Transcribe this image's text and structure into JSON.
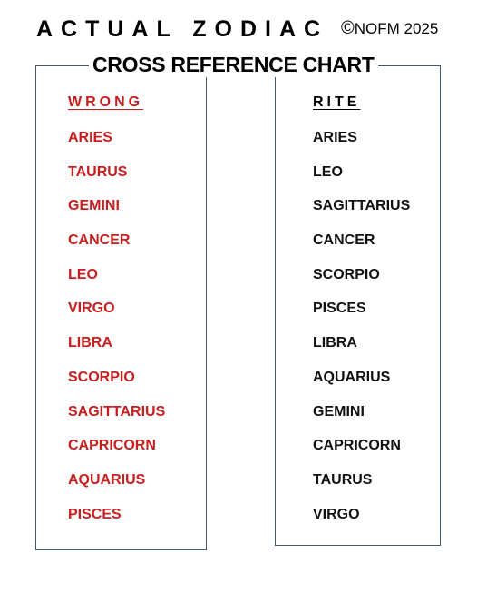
{
  "header": {
    "title": "ACTUAL ZODIAC",
    "copyright_symbol": "©",
    "copyright_text": "NOFM 2025",
    "subtitle": "CROSS REFERENCE CHART"
  },
  "columns": {
    "wrong": {
      "heading": "WRONG",
      "color": "#c81e1e",
      "items": [
        "ARIES",
        "TAURUS",
        "GEMINI",
        "CANCER",
        "LEO",
        "VIRGO",
        "LIBRA",
        "SCORPIO",
        "SAGITTARIUS",
        "CAPRICORN",
        "AQUARIUS",
        "PISCES"
      ]
    },
    "rite": {
      "heading": "RITE",
      "color": "#000000",
      "items": [
        "ARIES",
        "LEO",
        "SAGITTARIUS",
        "CANCER",
        "SCORPIO",
        "PISCES",
        "LIBRA",
        "AQUARIUS",
        "GEMINI",
        "CAPRICORN",
        "TAURUS",
        "VIRGO"
      ]
    }
  },
  "colors": {
    "frame": "#3f5a73",
    "wrong_text": "#c81e1e",
    "rite_text": "#000000"
  }
}
